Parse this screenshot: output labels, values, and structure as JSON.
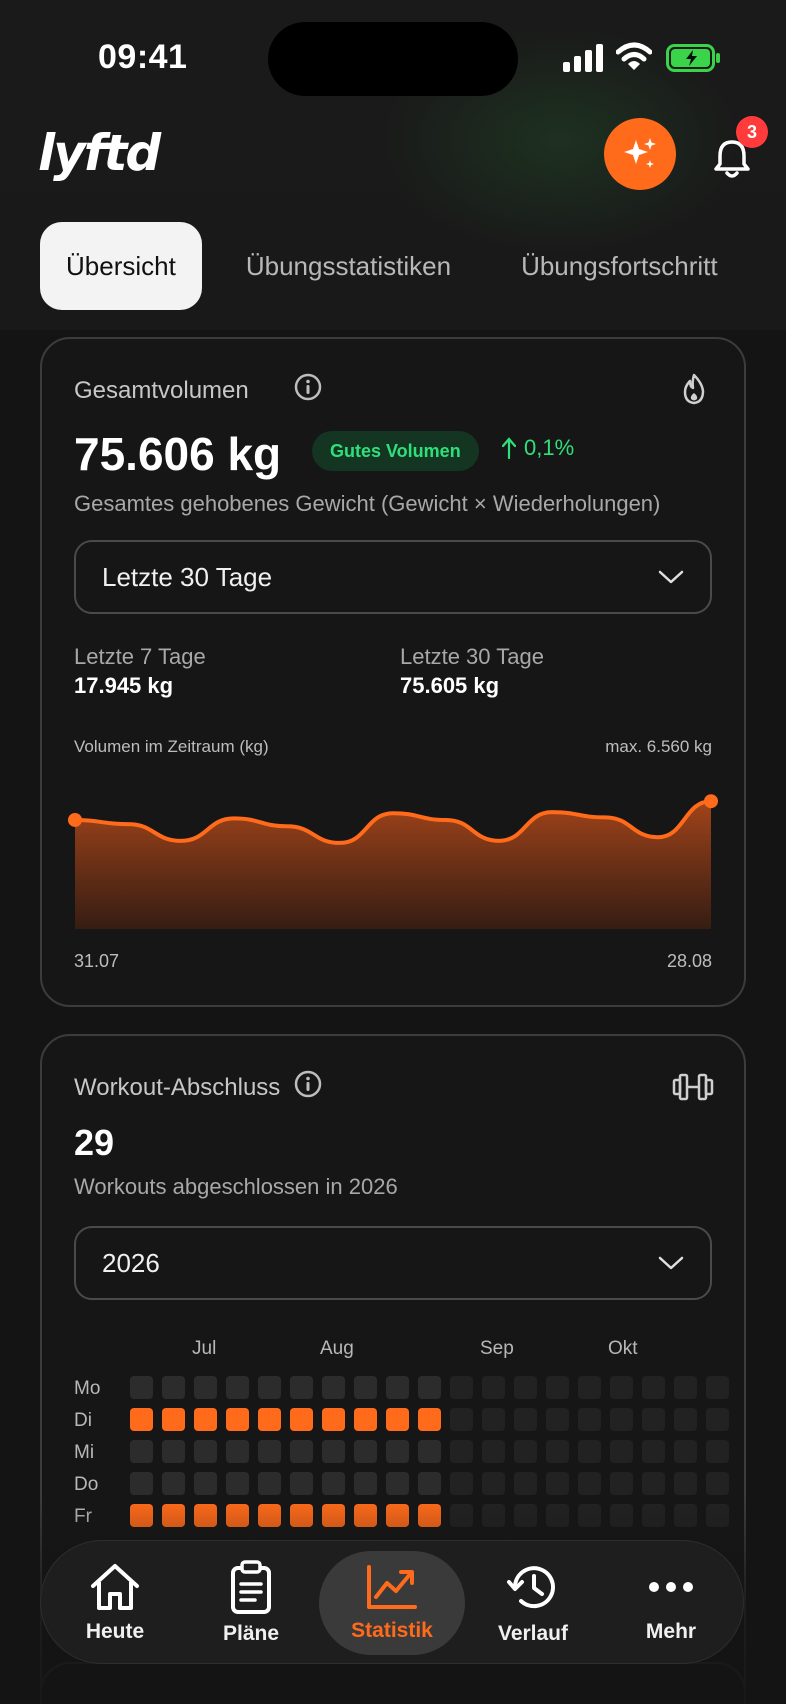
{
  "status_bar": {
    "time": "09:41"
  },
  "header": {
    "logo_text": "lyftd",
    "ai_button_icon": "sparkles-icon",
    "notification_icon": "bell-icon",
    "notification_count": "3"
  },
  "tabs": [
    {
      "label": "Übersicht",
      "active": true
    },
    {
      "label": "Übungsstatistiken",
      "active": false
    },
    {
      "label": "Übungsfortschritt",
      "active": false
    }
  ],
  "volume_card": {
    "title": "Gesamtvolumen",
    "icon": "flame-icon",
    "total": "75.606 kg",
    "badge": "Gutes Volumen",
    "trend": "0,1%",
    "description": "Gesamtes gehobenes Gewicht (Gewicht × Wiederholungen)",
    "period_select": "Letzte 30 Tage",
    "stats": [
      {
        "label": "Letzte 7 Tage",
        "value": "17.945 kg"
      },
      {
        "label": "Letzte 30 Tage",
        "value": "75.605 kg"
      }
    ]
  },
  "chart_data": {
    "type": "area",
    "title": "Volumen im Zeitraum (kg)",
    "annotation": "max. 6.560 kg",
    "x_start": "31.07",
    "x_end": "28.08",
    "y_max": 6560,
    "values": [
      6200,
      6120,
      5800,
      6230,
      6080,
      5760,
      6330,
      6200,
      5800,
      6350,
      6250,
      5870,
      6560
    ],
    "color": "#ff6b1a"
  },
  "workout_card": {
    "title": "Workout-Abschluss",
    "icon": "dumbbell-icon",
    "count": "29",
    "description": "Workouts abgeschlossen in 2026",
    "year_select": "2026",
    "months": [
      "Jul",
      "Aug",
      "Sep",
      "Okt"
    ],
    "days": [
      "Mo",
      "Di",
      "Mi",
      "Do",
      "Fr"
    ],
    "active_rows": [
      "Di",
      "Fr"
    ],
    "active_weeks": 10,
    "accent": "#ff6b1a"
  },
  "nav": [
    {
      "label": "Heute",
      "icon": "home-icon",
      "active": false
    },
    {
      "label": "Pläne",
      "icon": "clipboard-icon",
      "active": false
    },
    {
      "label": "Statistik",
      "icon": "chart-icon",
      "active": true
    },
    {
      "label": "Verlauf",
      "icon": "history-icon",
      "active": false
    },
    {
      "label": "Mehr",
      "icon": "more-icon",
      "active": false
    }
  ]
}
